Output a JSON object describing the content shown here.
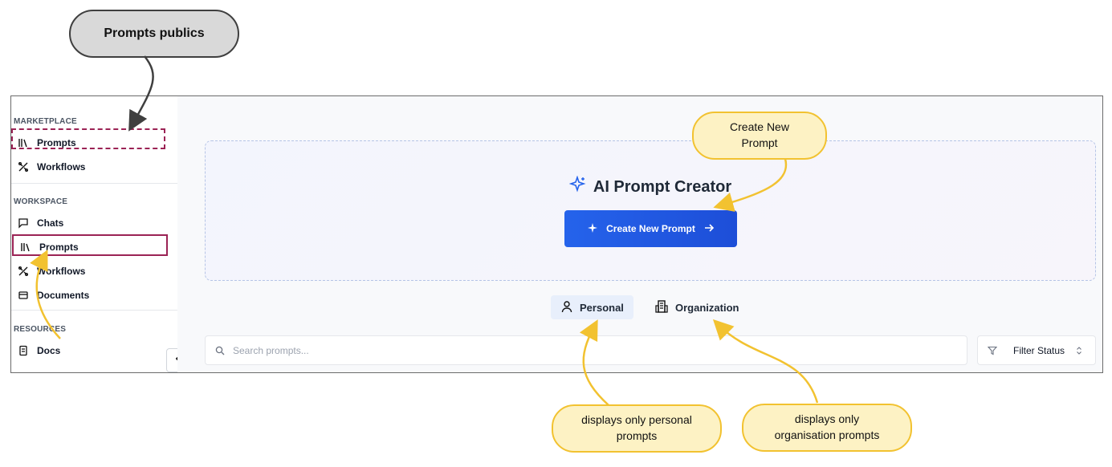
{
  "sidebar": {
    "marketplace_label": "MARKETPLACE",
    "marketplace_items": [
      {
        "label": "Prompts",
        "icon": "library-icon"
      },
      {
        "label": "Workflows",
        "icon": "workflow-icon"
      }
    ],
    "workspace_label": "WORKSPACE",
    "workspace_items": [
      {
        "label": "Chats",
        "icon": "chat-icon"
      },
      {
        "label": "Prompts",
        "icon": "library-icon"
      },
      {
        "label": "Workflows",
        "icon": "workflow-icon"
      },
      {
        "label": "Documents",
        "icon": "document-icon"
      }
    ],
    "resources_label": "RESOURCES",
    "resources_items": [
      {
        "label": "Docs",
        "icon": "docs-icon"
      }
    ]
  },
  "hero": {
    "title": "AI Prompt Creator",
    "create_button": "Create New Prompt"
  },
  "tabs": [
    {
      "label": "Personal",
      "icon": "user-icon",
      "active": true
    },
    {
      "label": "Organization",
      "icon": "building-icon",
      "active": false
    }
  ],
  "search": {
    "placeholder": "Search prompts..."
  },
  "filter": {
    "label": "Filter Status"
  },
  "annotations": {
    "public_prompts": "Prompts publics",
    "create_new": "Create New Prompt",
    "personal": "displays only personal prompts",
    "organisation": "displays only organisation prompts"
  },
  "colors": {
    "accent": "#2563eb",
    "annotation_box": "#9b2355",
    "callout_yellow": "#fdf2c4",
    "callout_border": "#f2c230"
  }
}
